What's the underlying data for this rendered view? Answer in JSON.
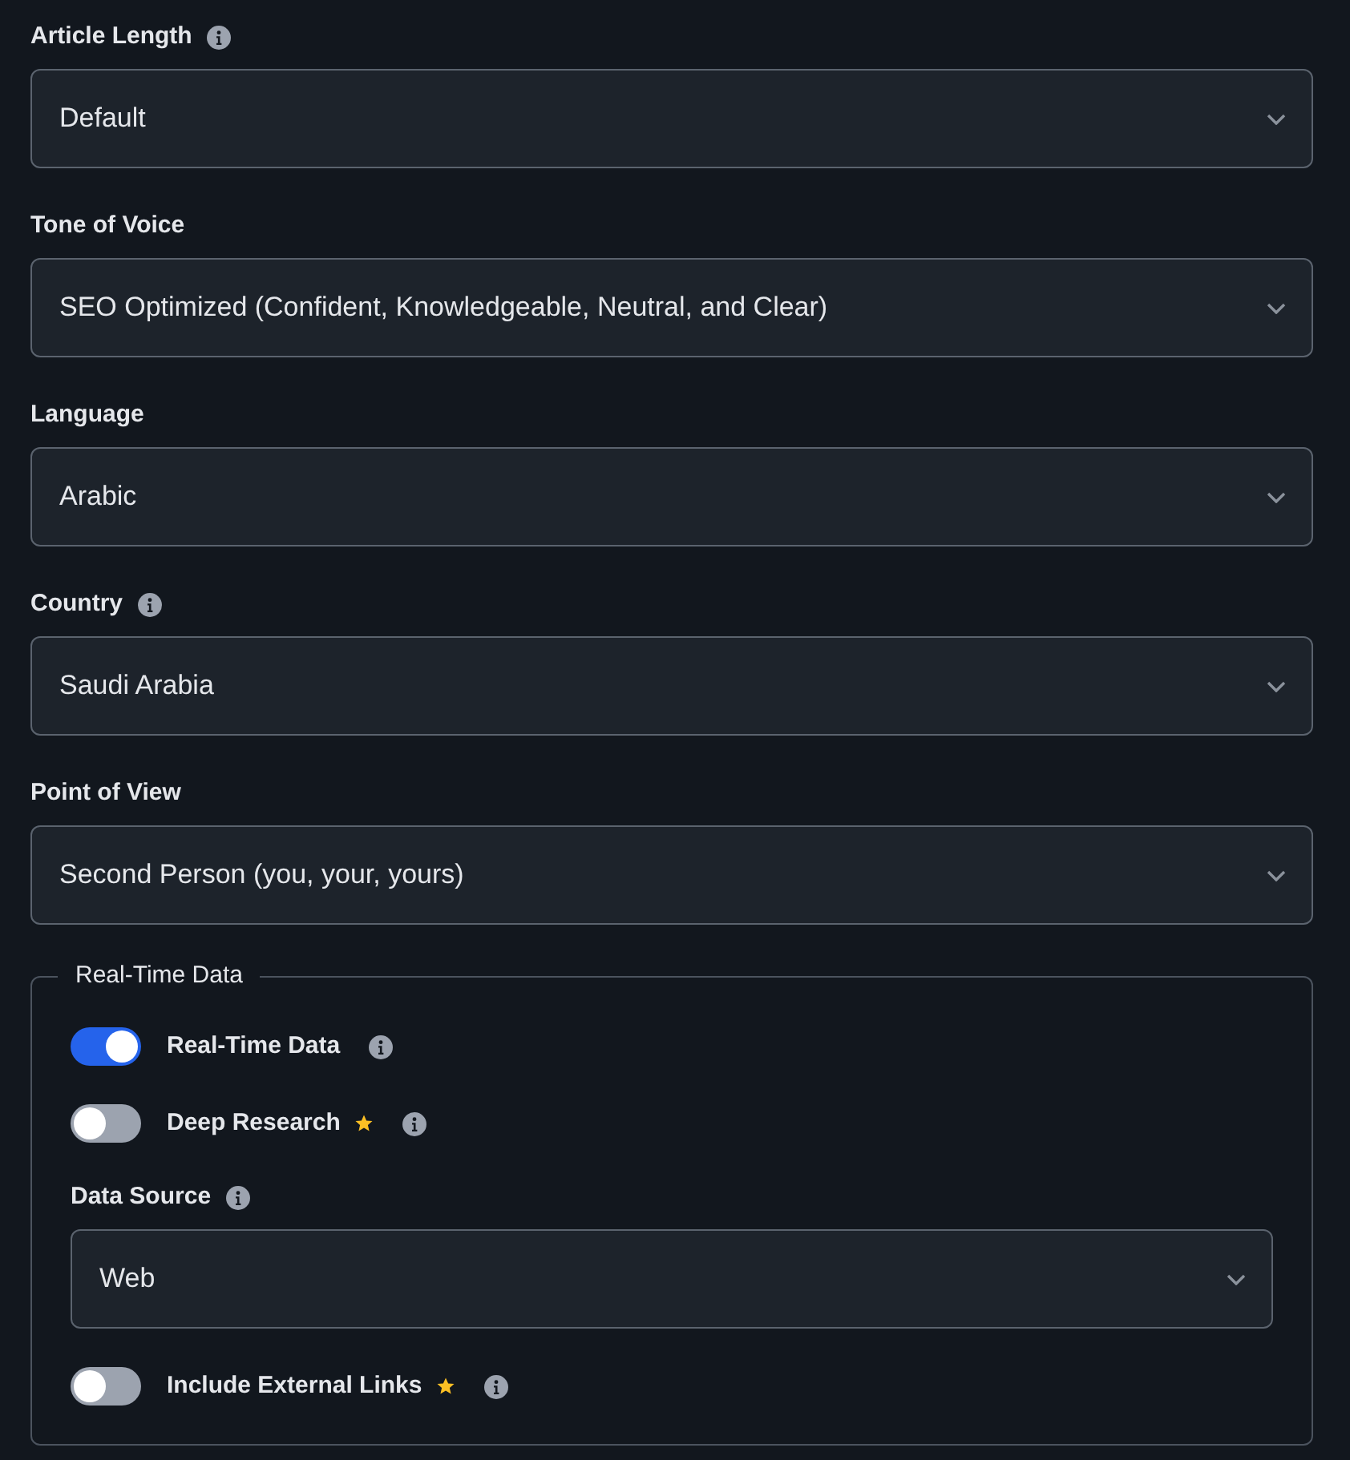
{
  "fields": [
    {
      "label": "Article Length",
      "info": true,
      "value": "Default"
    },
    {
      "label": "Tone of Voice",
      "info": false,
      "value": "SEO Optimized (Confident, Knowledgeable, Neutral, and Clear)"
    },
    {
      "label": "Language",
      "info": false,
      "value": "Arabic"
    },
    {
      "label": "Country",
      "info": true,
      "value": "Saudi Arabia"
    },
    {
      "label": "Point of View",
      "info": false,
      "value": "Second Person (you, your, yours)"
    }
  ],
  "real_time_section": {
    "legend": "Real-Time Data",
    "items": [
      {
        "kind": "toggle",
        "label": "Real-Time Data",
        "on": true,
        "premium": false,
        "info": true
      },
      {
        "kind": "toggle",
        "label": "Deep Research",
        "on": false,
        "premium": true,
        "info": true
      },
      {
        "kind": "select",
        "label": "Data Source",
        "info": true,
        "value": "Web"
      },
      {
        "kind": "toggle",
        "label": "Include External Links",
        "on": false,
        "premium": true,
        "info": true
      }
    ]
  }
}
